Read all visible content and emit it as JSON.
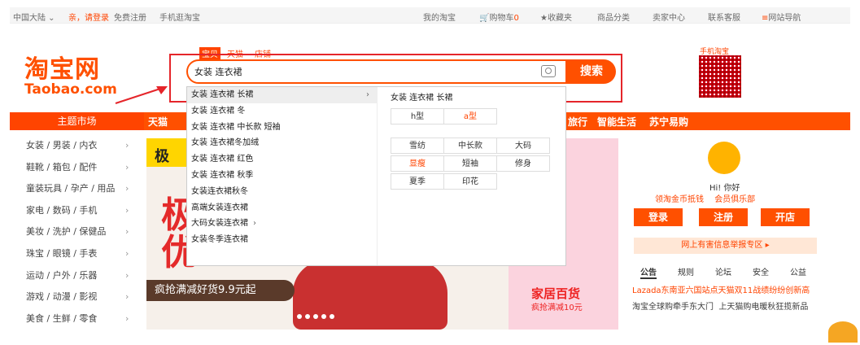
{
  "topbar": {
    "region": "中国大陆",
    "login": "亲，请登录",
    "register": "免费注册",
    "mobile": "手机逛淘宝",
    "my_taobao": "我的淘宝",
    "cart": "购物车",
    "cart_count": "0",
    "favorites": "收藏夹",
    "categories": "商品分类",
    "seller": "卖家中心",
    "service": "联系客服",
    "sitemap": "网站导航"
  },
  "logo": {
    "cn": "淘宝网",
    "en": "Taobao.com"
  },
  "search": {
    "tabs": [
      "宝贝",
      "天猫",
      "店铺"
    ],
    "value": "女装 连衣裙",
    "button": "搜索"
  },
  "qr_label": "手机淘宝",
  "suggestions": [
    "女装 连衣裙 长裙",
    "女装 连衣裙 冬",
    "女装 连衣裙 中长款 短袖",
    "女装 连衣裙冬加绒",
    "女装 连衣裙 红色",
    "女装 连衣裙 秋季",
    "女装连衣裙秋冬",
    "高端女装连衣裙",
    "大码女装连衣裙",
    "女装冬季连衣裙"
  ],
  "suggest_panel": {
    "title": "女装 连衣裙 长裙",
    "row1": [
      "h型",
      "a型"
    ],
    "grid": [
      "雪纺",
      "中长款",
      "大码",
      "显瘦",
      "短袖",
      "修身",
      "夏季",
      "印花"
    ]
  },
  "nav": {
    "theme": "主题市场",
    "tmall": "天猫",
    "items": [
      "旅行",
      "智能生活",
      "苏宁易购"
    ]
  },
  "categories": [
    "女装 / 男装 / 内衣",
    "鞋靴 / 箱包 / 配件",
    "童装玩具 / 孕产 / 用品",
    "家电 / 数码 / 手机",
    "美妆 / 洗护 / 保健品",
    "珠宝 / 眼镜 / 手表",
    "运动 / 户外 / 乐器",
    "游戏 / 动漫 / 影视",
    "美食 / 生鲜 / 零食"
  ],
  "banner": {
    "badge": "极",
    "headline1": "极",
    "headline2": "优",
    "promo": "疯抢满减好货9.9元起",
    "home_title": "家居百货",
    "home_sub": "疯抢满减10元"
  },
  "user_panel": {
    "greeting": "Hi! 你好",
    "badge1": "领淘金币抵钱",
    "badge2": "会员俱乐部",
    "login": "登录",
    "register": "注册",
    "open_shop": "开店",
    "report": "网上有害信息举报专区",
    "tabs": [
      "公告",
      "规则",
      "论坛",
      "安全",
      "公益"
    ],
    "news1": "Lazada东南亚六国站点天猫双11战绩纷纷创新高",
    "news2": "淘宝全球购牵手东大门",
    "news3": "上天猫购电暖秋狂揽新品"
  },
  "colors": {
    "brand": "#ff5000",
    "highlight_box": "#e5252a"
  }
}
